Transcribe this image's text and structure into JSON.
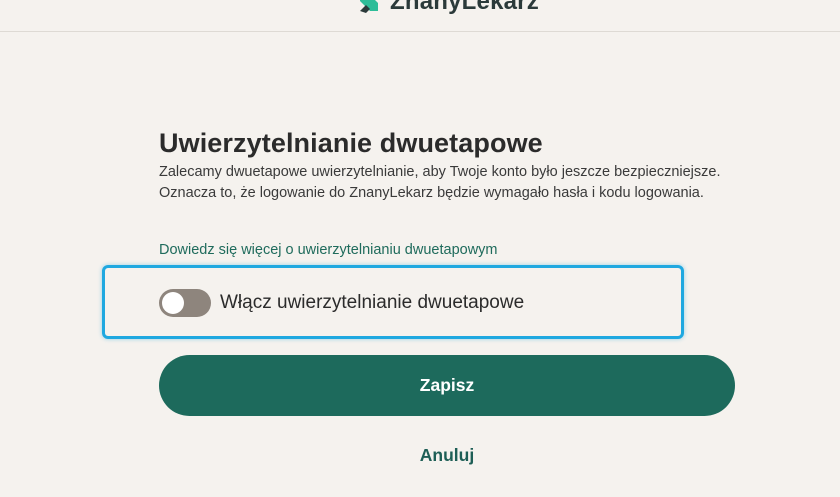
{
  "header": {
    "logo_text": "ZnanyLekarz",
    "logo_icon": "znanylekarz-logo-icon",
    "brand_color": "#2dbd98"
  },
  "main": {
    "title": "Uwierzytelnianie dwuetapowe",
    "description": "Zalecamy dwuetapowe uwierzytelnianie, aby Twoje konto było jeszcze bezpieczniejsze. Oznacza to, że logowanie do ZnanyLekarz będzie wymagało hasła i kodu logowania.",
    "learn_more_link": "Dowiedz się więcej o uwierzytelnianiu dwuetapowym",
    "toggle": {
      "label": "Włącz uwierzytelnianie dwuetapowe",
      "state": "off"
    },
    "save_button": "Zapisz",
    "cancel_link": "Anuluj"
  },
  "colors": {
    "accent": "#1d6a5c",
    "highlight_border": "#1fa8e0",
    "background": "#f5f2ee"
  }
}
